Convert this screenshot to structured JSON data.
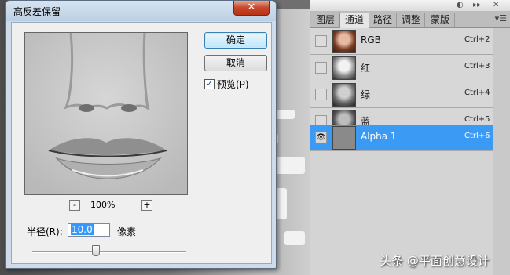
{
  "dialog": {
    "title": "高反差保留",
    "close_label": "✕",
    "ok_label": "确定",
    "cancel_label": "取消",
    "preview_label": "预览(P)",
    "preview_checked": true,
    "zoom_out_label": "-",
    "zoom_in_label": "+",
    "zoom_level": "100%",
    "radius_label": "半径(R):",
    "radius_value": "10.0",
    "unit_label": "像素"
  },
  "panel": {
    "tabs": [
      "图层",
      "通道",
      "路径",
      "调整",
      "蒙版"
    ],
    "active_tab": "通道",
    "menu_icon": "panel-menu-icon",
    "channels": [
      {
        "name": "RGB",
        "shortcut": "Ctrl+2",
        "thumb": "color",
        "visible": false,
        "selected": false
      },
      {
        "name": "红",
        "shortcut": "Ctrl+3",
        "thumb": "gray-light",
        "visible": false,
        "selected": false
      },
      {
        "name": "绿",
        "shortcut": "Ctrl+4",
        "thumb": "gray",
        "visible": false,
        "selected": false
      },
      {
        "name": "蓝",
        "shortcut": "Ctrl+5",
        "thumb": "gray-dark",
        "visible": false,
        "selected": false
      },
      {
        "name": "Alpha 1",
        "shortcut": "Ctrl+6",
        "thumb": "high-pass",
        "visible": true,
        "selected": true
      }
    ]
  },
  "watermark": "头条 @平面创意设计",
  "colors": {
    "selection": "#3b9af3",
    "dialog_frame": "#cfdbe8",
    "close_button": "#c8452a"
  }
}
